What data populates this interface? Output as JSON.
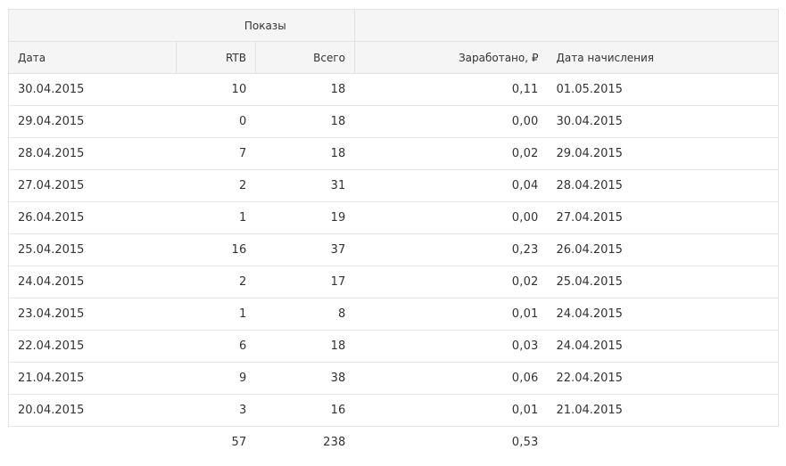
{
  "header": {
    "group_label": "Показы",
    "columns": [
      "Дата",
      "RTB",
      "Всего",
      "Заработано, ₽",
      "Дата начисления"
    ]
  },
  "rows": [
    {
      "date": "30.04.2015",
      "rtb": "10",
      "total": "18",
      "earned": "0,11",
      "accrual": "01.05.2015"
    },
    {
      "date": "29.04.2015",
      "rtb": "0",
      "total": "18",
      "earned": "0,00",
      "accrual": "30.04.2015"
    },
    {
      "date": "28.04.2015",
      "rtb": "7",
      "total": "18",
      "earned": "0,02",
      "accrual": "29.04.2015"
    },
    {
      "date": "27.04.2015",
      "rtb": "2",
      "total": "31",
      "earned": "0,04",
      "accrual": "28.04.2015"
    },
    {
      "date": "26.04.2015",
      "rtb": "1",
      "total": "19",
      "earned": "0,00",
      "accrual": "27.04.2015"
    },
    {
      "date": "25.04.2015",
      "rtb": "16",
      "total": "37",
      "earned": "0,23",
      "accrual": "26.04.2015"
    },
    {
      "date": "24.04.2015",
      "rtb": "2",
      "total": "17",
      "earned": "0,02",
      "accrual": "25.04.2015"
    },
    {
      "date": "23.04.2015",
      "rtb": "1",
      "total": "8",
      "earned": "0,01",
      "accrual": "24.04.2015"
    },
    {
      "date": "22.04.2015",
      "rtb": "6",
      "total": "18",
      "earned": "0,03",
      "accrual": "24.04.2015"
    },
    {
      "date": "21.04.2015",
      "rtb": "9",
      "total": "38",
      "earned": "0,06",
      "accrual": "22.04.2015"
    },
    {
      "date": "20.04.2015",
      "rtb": "3",
      "total": "16",
      "earned": "0,01",
      "accrual": "21.04.2015"
    }
  ],
  "totals": {
    "rtb": "57",
    "total": "238",
    "earned": "0,53"
  }
}
